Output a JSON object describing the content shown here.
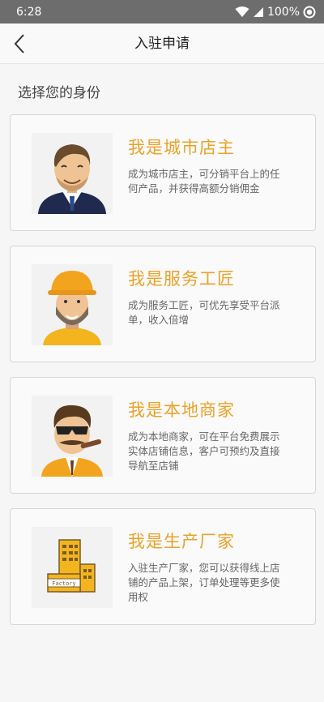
{
  "status": {
    "time": "6:28",
    "battery": "100%"
  },
  "header": {
    "title": "入驻申请"
  },
  "subtitle": "选择您的身份",
  "cards": [
    {
      "title": "我是城市店主",
      "desc": "成为城市店主，可分销平台上的任何产品，并获得高额分销佣金",
      "icon": "shop-owner-avatar"
    },
    {
      "title": "我是服务工匠",
      "desc": "成为服务工匠，可优先享受平台派单，收入倍增",
      "icon": "craftsman-avatar"
    },
    {
      "title": "我是本地商家",
      "desc": "成为本地商家，可在平台免费展示实体店铺信息，客户可预约及直接导航至店铺",
      "icon": "merchant-avatar"
    },
    {
      "title": "我是生产厂家",
      "desc": "入驻生产厂家，您可以获得线上店铺的产品上架，订单处理等更多使用权",
      "icon": "factory-icon",
      "badge": "Factory"
    }
  ],
  "colors": {
    "accent": "#e9a228",
    "statusbar": "#6d6d6d"
  }
}
